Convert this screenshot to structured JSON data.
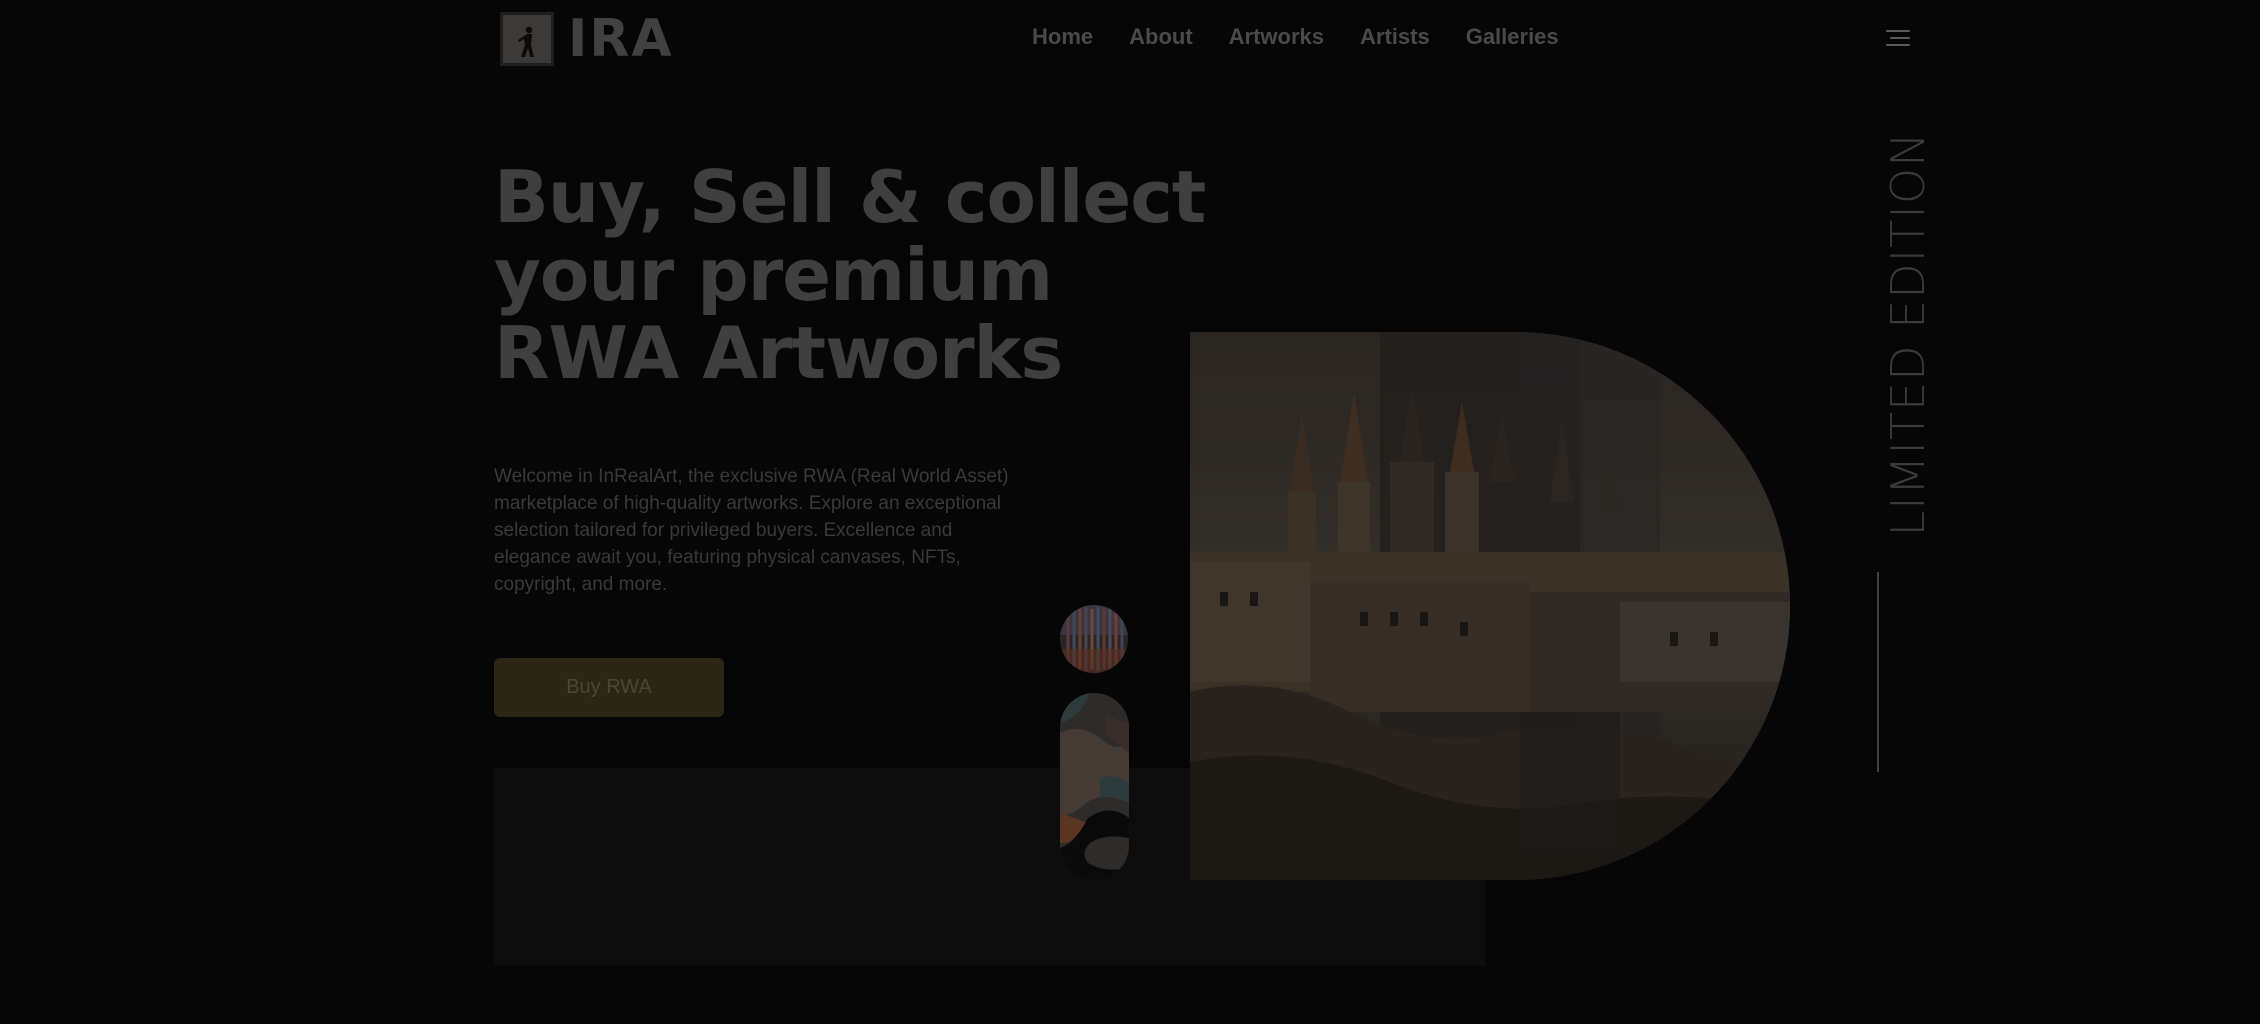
{
  "brand": {
    "name": "IRA",
    "logo_icon": "figure-logo-icon"
  },
  "nav": {
    "items": [
      "Home",
      "About",
      "Artworks",
      "Artists",
      "Galleries"
    ],
    "menu_icon": "menu-icon"
  },
  "hero": {
    "title_lines": [
      "Buy, Sell & collect",
      "your premium",
      "RWA Artworks"
    ],
    "description": "Welcome in InRealArt, the exclusive RWA (Real World Asset) marketplace of high-quality artworks. Explore an exceptional selection tailored for privileged buyers. Excellence and elegance await you, featuring physical canvases, NFTs, copyright, and more.",
    "cta_label": "Buy RWA"
  },
  "side": {
    "label": "LIMITED EDITION"
  },
  "colors": {
    "background": "#060606",
    "cta_background": "#2c2617",
    "text": "#3f3f3f"
  }
}
